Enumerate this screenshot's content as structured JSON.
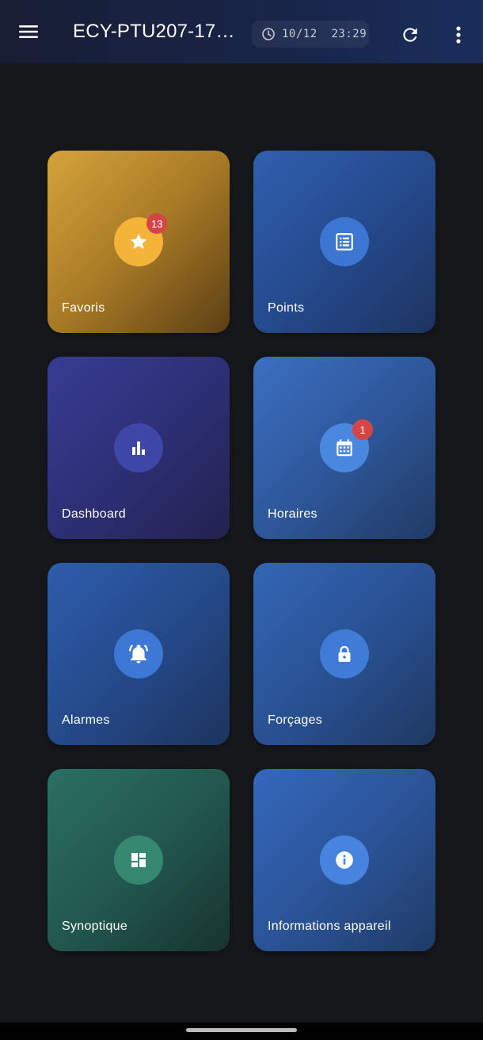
{
  "appbar": {
    "title": "ECY-PTU207-173...",
    "datetime": "10/12  23:29",
    "menu_icon": "hamburger-menu-icon",
    "refresh_icon": "refresh-icon",
    "more_icon": "more-vert-icon",
    "clock_icon": "clock-icon"
  },
  "tiles": [
    {
      "label": "Favoris",
      "icon": "star-icon",
      "badge": "13"
    },
    {
      "label": "Points",
      "icon": "list-icon"
    },
    {
      "label": "Dashboard",
      "icon": "bar-chart-icon"
    },
    {
      "label": "Horaires",
      "icon": "calendar-icon",
      "badge": "1"
    },
    {
      "label": "Alarmes",
      "icon": "alarm-bell-icon"
    },
    {
      "label": "Forçages",
      "icon": "lock-icon"
    },
    {
      "label": "Synoptique",
      "icon": "dashboard-layout-icon"
    },
    {
      "label": "Informations appareil",
      "icon": "info-icon"
    }
  ]
}
